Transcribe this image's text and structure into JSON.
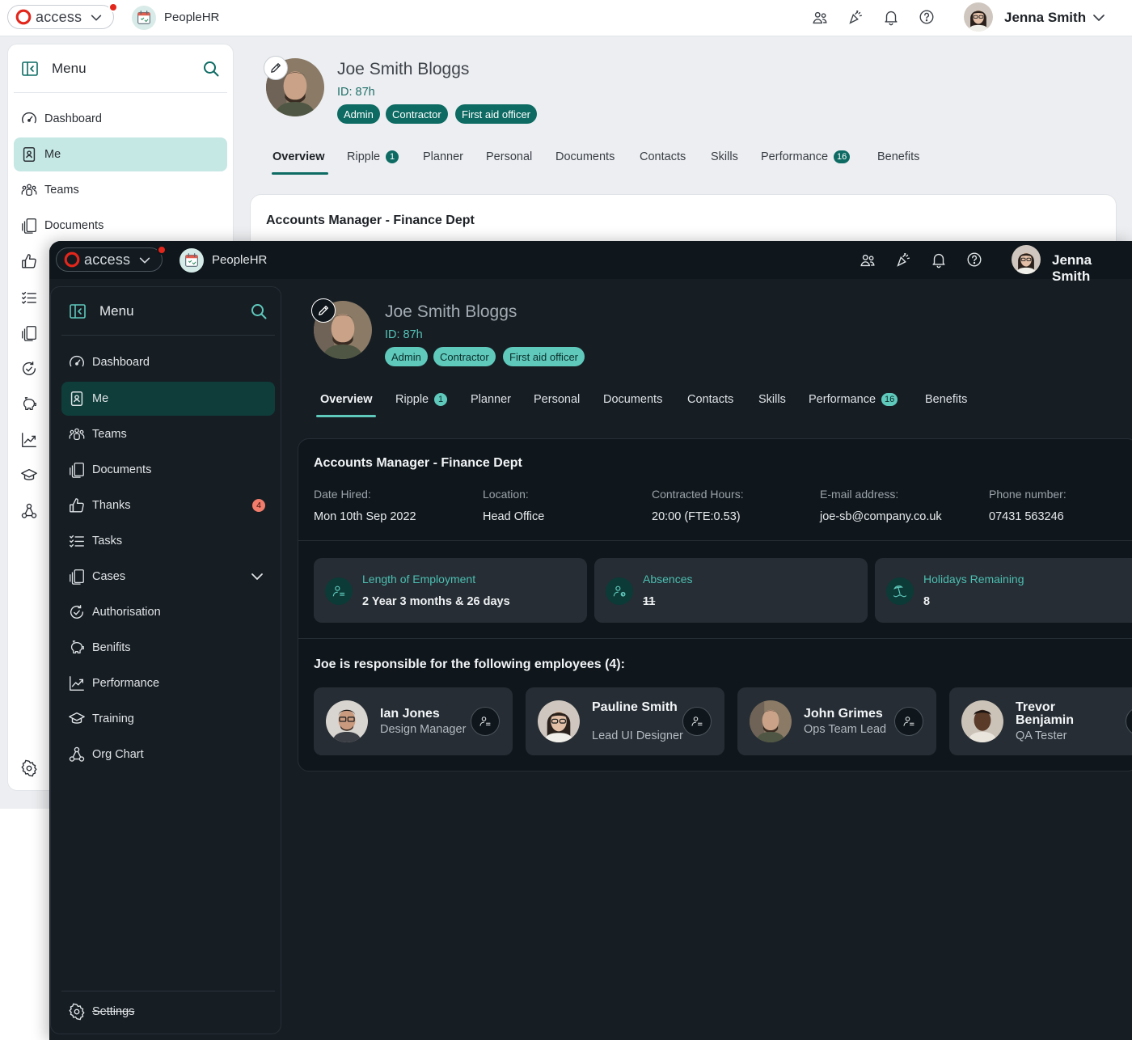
{
  "brand": {
    "access_word": "access",
    "app_name": "PeopleHR"
  },
  "user": {
    "name": "Jenna Smith"
  },
  "menu": {
    "title": "Menu",
    "items": [
      {
        "label": "Dashboard"
      },
      {
        "label": "Me"
      },
      {
        "label": "Teams"
      },
      {
        "label": "Documents"
      },
      {
        "label": "Thanks",
        "badge": "4"
      },
      {
        "label": "Tasks"
      },
      {
        "label": "Cases"
      },
      {
        "label": "Authorisation"
      },
      {
        "label": "Benifits"
      },
      {
        "label": "Performance"
      },
      {
        "label": "Training"
      },
      {
        "label": "Org Chart"
      }
    ],
    "settings_label": "Settings"
  },
  "profile": {
    "name": "Joe Smith Bloggs",
    "id_text": "ID: 87h",
    "tags": [
      "Admin",
      "Contractor",
      "First aid officer"
    ]
  },
  "tabs": [
    {
      "label": "Overview"
    },
    {
      "label": "Ripple",
      "count": "1"
    },
    {
      "label": "Planner"
    },
    {
      "label": "Personal"
    },
    {
      "label": "Documents"
    },
    {
      "label": "Contacts"
    },
    {
      "label": "Skills"
    },
    {
      "label": "Performance",
      "count": "16"
    },
    {
      "label": "Benefits"
    }
  ],
  "job": {
    "title": "Accounts Manager - Finance Dept",
    "fields": [
      {
        "label": "Date Hired:",
        "value": "Mon 10th Sep 2022"
      },
      {
        "label": "Location:",
        "value": "Head Office"
      },
      {
        "label": "Contracted Hours:",
        "value": "20:00 (FTE:0.53)"
      },
      {
        "label": "E-mail address:",
        "value": "joe-sb@company.co.uk"
      },
      {
        "label": "Phone number:",
        "value": "07431 563246"
      }
    ]
  },
  "stats": [
    {
      "label": "Length of Employment",
      "value": "2 Year 3 months & 26 days"
    },
    {
      "label": "Absences",
      "value": "11"
    },
    {
      "label": "Holidays Remaining",
      "value": "8"
    }
  ],
  "responsible": {
    "title": "Joe is responsible for the following employees (4):",
    "employees": [
      {
        "name": "Ian Jones",
        "role": "Design Manager"
      },
      {
        "name": "Pauline Smith",
        "role": "Lead UI Designer"
      },
      {
        "name": "John Grimes",
        "role": "Ops Team Lead"
      },
      {
        "name": "Trevor Benjamin",
        "role": "QA Tester"
      }
    ]
  },
  "colors": {
    "accent_light": "#0d6b63",
    "accent_dark": "#5fc9bc",
    "active_nav_light": "#c5e8e4",
    "active_nav_dark": "#0f3d3a",
    "notification_dot": "#e3261b",
    "dark_bg": "#161d23"
  }
}
